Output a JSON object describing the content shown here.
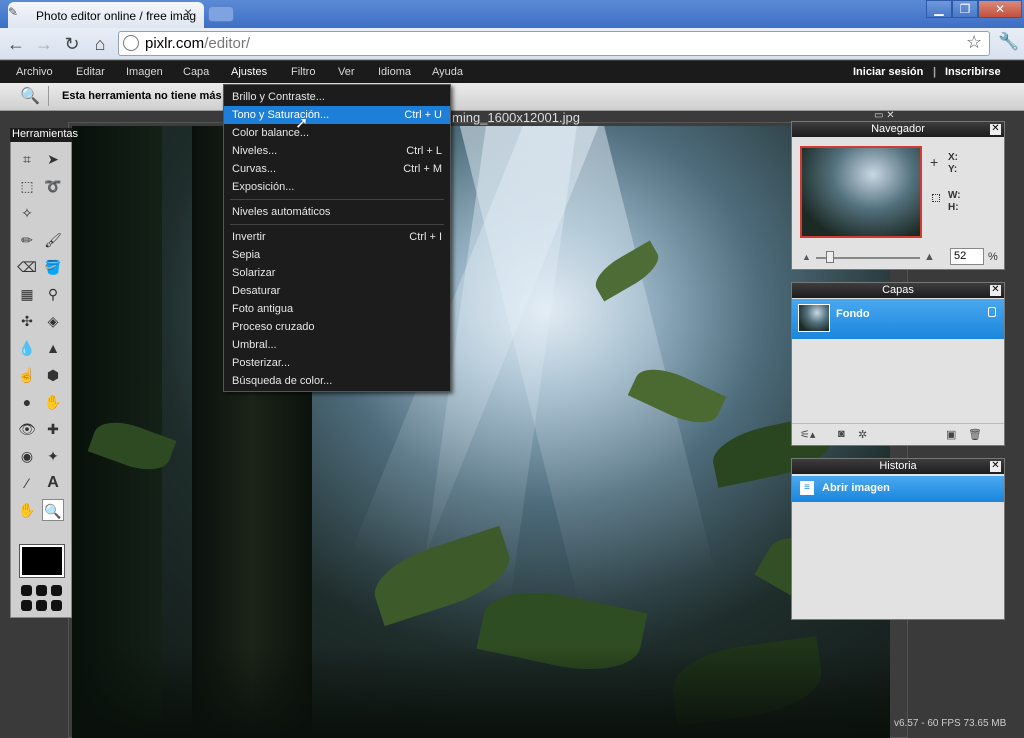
{
  "browser": {
    "tab_title": "Photo editor online / free imag",
    "tab_close": "×",
    "url_host": "pixlr.com",
    "url_path": "/editor/",
    "window_buttons": [
      "▁",
      "❐",
      "✕"
    ]
  },
  "menubar": {
    "items": [
      "Archivo",
      "Editar",
      "Imagen",
      "Capa",
      "Ajustes",
      "Filtro",
      "Ver",
      "Idioma",
      "Ayuda"
    ],
    "login": "Iniciar sesión",
    "separator": "|",
    "signup": "Inscribirse"
  },
  "options_bar": {
    "message": "Esta herramienta no tiene más"
  },
  "document": {
    "title": "ming_1600x12001.jpg",
    "status": "v6.57 - 60 FPS 73.65 MB"
  },
  "tools_panel": {
    "title": "Herramientas"
  },
  "dropdown": {
    "items": [
      {
        "label": "Brillo y Contraste...",
        "shortcut": ""
      },
      {
        "label": "Tono y Saturación...",
        "shortcut": "Ctrl + U",
        "highlighted": true
      },
      {
        "label": "Color balance...",
        "shortcut": ""
      },
      {
        "label": "Niveles...",
        "shortcut": "Ctrl + L"
      },
      {
        "label": "Curvas...",
        "shortcut": "Ctrl + M"
      },
      {
        "label": "Exposición...",
        "shortcut": ""
      },
      {
        "label": "Niveles automáticos",
        "shortcut": ""
      },
      {
        "label": "Invertir",
        "shortcut": "Ctrl + I"
      },
      {
        "label": "Sepia",
        "shortcut": ""
      },
      {
        "label": "Solarizar",
        "shortcut": ""
      },
      {
        "label": "Desaturar",
        "shortcut": ""
      },
      {
        "label": "Foto antigua",
        "shortcut": ""
      },
      {
        "label": "Proceso cruzado",
        "shortcut": ""
      },
      {
        "label": "Umbral...",
        "shortcut": ""
      },
      {
        "label": "Posterizar...",
        "shortcut": ""
      },
      {
        "label": "Búsqueda de color...",
        "shortcut": ""
      }
    ]
  },
  "navigator": {
    "title": "Navegador",
    "x_label": "X:",
    "y_label": "Y:",
    "w_label": "W:",
    "h_label": "H:",
    "zoom": "52",
    "zoom_unit": "%"
  },
  "layers": {
    "title": "Capas",
    "layer_name": "Fondo"
  },
  "history": {
    "title": "Historia",
    "entry": "Abrir imagen"
  },
  "colors": {
    "accent": "#1a86dc",
    "menubar": "#1b1b1b",
    "foreground_color": "#000000"
  }
}
